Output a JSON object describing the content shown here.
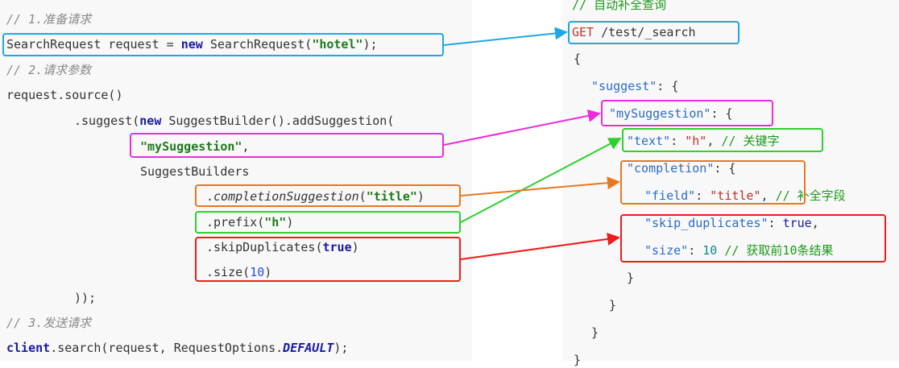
{
  "left": {
    "c1": "// 1.准备请求",
    "l1": {
      "a": "SearchRequest request = ",
      "kw": "new",
      "b": " SearchRequest(",
      "s": "\"hotel\"",
      "c": ");"
    },
    "c2": "// 2.请求参数",
    "l2": "request.source()",
    "l3": {
      "a": ".suggest(",
      "kw": "new",
      "b": " SuggestBuilder().addSuggestion("
    },
    "l4": {
      "s": "\"mySuggestion\"",
      "c": ","
    },
    "l5": "SuggestBuilders",
    "l6": {
      "a": ".",
      "m": "completionSuggestion",
      "b": "(",
      "s": "\"title\"",
      "c": ")"
    },
    "l7": {
      "a": ".prefix(",
      "s": "\"h\"",
      "c": ")"
    },
    "l8": {
      "a": ".skipDuplicates(",
      "kw": "true",
      "c": ")"
    },
    "l9": {
      "a": ".size(",
      "n": "10",
      "c": ")"
    },
    "l10": "));",
    "c3": "// 3.发送请求",
    "l11": {
      "a": "client",
      "b": ".search(request, RequestOptions.",
      "c": "DEFAULT",
      "d": ");"
    }
  },
  "right": {
    "c0": "// 自动补全查询",
    "r1": {
      "get": "GET",
      "path": " /test/_search"
    },
    "r2": "{",
    "r3": {
      "k": "\"suggest\"",
      "c": ": {"
    },
    "r4": {
      "k": "\"mySuggestion\"",
      "c": ": {"
    },
    "r5": {
      "k": "\"text\"",
      "c": ": ",
      "v": "\"h\"",
      "d": ", ",
      "cm": "// 关键字"
    },
    "r6": {
      "k": "\"completion\"",
      "c": ": {"
    },
    "r7": {
      "k": "\"field\"",
      "c": ": ",
      "v": "\"title\"",
      "d": ", ",
      "cm": "// 补全字段"
    },
    "r8": {
      "k": "\"skip_duplicates\"",
      "c": ": ",
      "v": "true",
      "d": ","
    },
    "r9": {
      "k": "\"size\"",
      "c": ": ",
      "v": "10",
      "cm": " // 获取前10条结果"
    },
    "r10": "}",
    "r11": "}",
    "r12": "}",
    "r13": "}"
  },
  "colors": {
    "blue": "#1ea7e6",
    "magenta": "#ee2bdc",
    "green": "#2dd02d",
    "orange": "#e8771f",
    "red": "#ee1c1c"
  }
}
